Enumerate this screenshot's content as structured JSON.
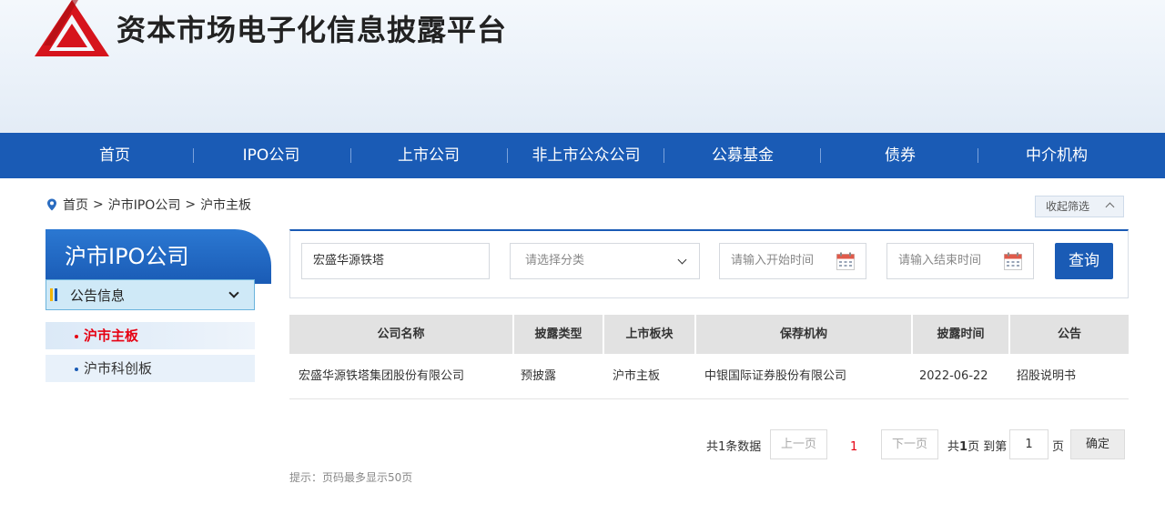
{
  "header": {
    "site_title": "资本市场电子化信息披露平台"
  },
  "nav": {
    "items": [
      "首页",
      "IPO公司",
      "上市公司",
      "非上市公众公司",
      "公募基金",
      "债券",
      "中介机构"
    ]
  },
  "breadcrumb": {
    "home": "首页",
    "sep": ">",
    "level1": "沪市IPO公司",
    "level2": "沪市主板"
  },
  "collapse_button": "收起筛选",
  "sidebar": {
    "title": "沪市IPO公司",
    "group": "公告信息",
    "items": [
      {
        "label": "沪市主板",
        "active": true
      },
      {
        "label": "沪市科创板",
        "active": false
      }
    ]
  },
  "filter": {
    "company_value": "宏盛华源铁塔",
    "category_placeholder": "请选择分类",
    "start_placeholder": "请输入开始时间",
    "end_placeholder": "请输入结束时间",
    "query_label": "查询"
  },
  "table": {
    "headers": [
      "公司名称",
      "披露类型",
      "上市板块",
      "保荐机构",
      "披露时间",
      "公告"
    ],
    "rows": [
      [
        "宏盛华源铁塔集团股份有限公司",
        "预披露",
        "沪市主板",
        "中银国际证券股份有限公司",
        "2022-06-22",
        "招股说明书"
      ]
    ]
  },
  "pagination": {
    "total_text": "共1条数据",
    "prev": "上一页",
    "current": "1",
    "next": "下一页",
    "pages_text_prefix": "共",
    "pages_count": "1",
    "pages_text_suffix": "页 到第",
    "goto_value": "1",
    "page_unit": "页",
    "confirm": "确定"
  },
  "tip": "提示：页码最多显示50页",
  "colors": {
    "brand_blue": "#1a5bb5",
    "active_red": "#e60012",
    "logo_red": "#d6141c"
  }
}
